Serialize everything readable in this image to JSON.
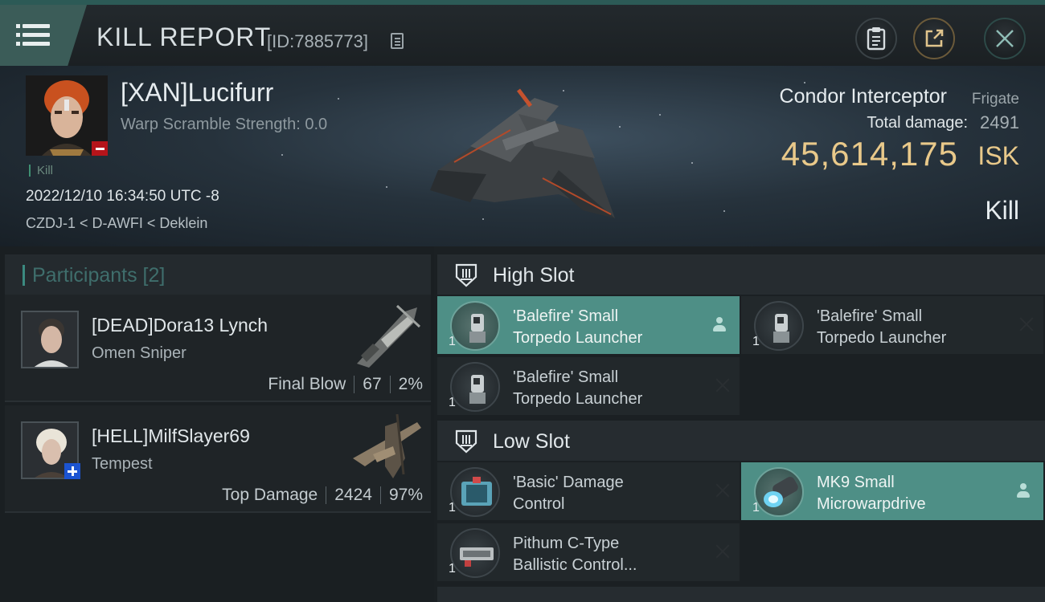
{
  "header": {
    "title": "KILL REPORT",
    "report_id": "[ID:7885773]"
  },
  "icons": {
    "menu": "menu-icon",
    "copy": "copy-icon",
    "clipboard": "clipboard-icon",
    "share": "share-icon",
    "close": "close-icon"
  },
  "victim": {
    "name": "[XAN]Lucifurr",
    "warp_scramble": "Warp Scramble Strength: 0.0",
    "tag": "Kill",
    "datetime": "2022/12/10 16:34:50 UTC -8",
    "location": "CZDJ-1 < D-AWFI < Deklein",
    "ship_name": "Condor Interceptor",
    "ship_class": "Frigate",
    "total_damage_label": "Total damage:",
    "total_damage": "2491",
    "isk_value": "45,614,175",
    "isk_unit": "ISK",
    "result": "Kill"
  },
  "participants": {
    "title": "Participants [2]",
    "list": [
      {
        "name": "[DEAD]Dora13 Lynch",
        "ship": "Omen Sniper",
        "role": "Final Blow",
        "damage": "67",
        "percent": "2%"
      },
      {
        "name": "[HELL]MilfSlayer69",
        "ship": "Tempest",
        "role": "Top Damage",
        "damage": "2424",
        "percent": "97%"
      }
    ]
  },
  "fitting": {
    "high_slot": {
      "label": "High Slot",
      "modules": [
        {
          "line1": "'Balefire' Small",
          "line2": "Torpedo Launcher",
          "qty": "1"
        },
        {
          "line1": "'Balefire' Small",
          "line2": "Torpedo Launcher",
          "qty": "1"
        },
        {
          "line1": "'Balefire' Small",
          "line2": "Torpedo Launcher",
          "qty": "1"
        }
      ]
    },
    "low_slot": {
      "label": "Low Slot",
      "modules": [
        {
          "line1": "'Basic' Damage",
          "line2": "Control",
          "qty": "1"
        },
        {
          "line1": "MK9 Small",
          "line2": "Microwarpdrive",
          "qty": "1"
        },
        {
          "line1": "Pithum C-Type",
          "line2": "Ballistic Control...",
          "qty": "1"
        }
      ]
    }
  },
  "colors": {
    "accent_teal": "#4e8f86",
    "isk_gold": "#e9c98a",
    "badge_red": "#b5141a",
    "badge_blue": "#1c54d1"
  }
}
